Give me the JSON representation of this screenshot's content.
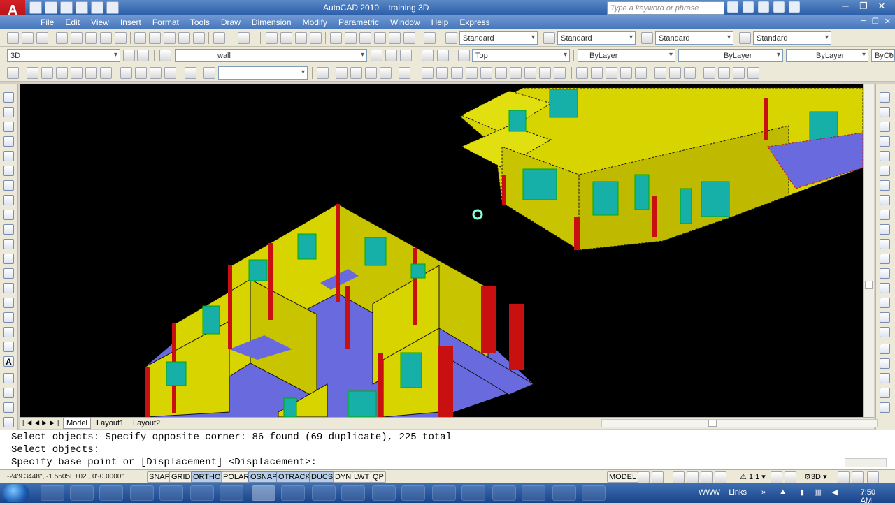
{
  "window": {
    "app_name": "AutoCAD 2010",
    "document_name": "training 3D",
    "search_placeholder": "Type a keyword or phrase",
    "app_logo_letter": "A"
  },
  "menu": [
    "File",
    "Edit",
    "View",
    "Insert",
    "Format",
    "Tools",
    "Draw",
    "Dimension",
    "Modify",
    "Parametric",
    "Window",
    "Help",
    "Express"
  ],
  "toolbar1": {
    "text_style": "Standard",
    "dim_style": "Standard",
    "table_style": "Standard",
    "mleader_style": "Standard"
  },
  "toolbar2": {
    "workspace": "3D",
    "layer": "wall",
    "view": "Top",
    "color": "ByLayer",
    "linetype": "ByLayer",
    "lineweight": "ByLayer",
    "plotstyle": "ByCo"
  },
  "tabs": [
    "Model",
    "Layout1",
    "Layout2"
  ],
  "command_lines": [
    "Select objects: Specify opposite corner: 86 found (69 duplicate), 225 total",
    "Select objects:",
    "Specify base point or [Displacement] <Displacement>:"
  ],
  "status": {
    "coordinates": "-24'9.3448\", -1.5505E+02 , 0'-0.0000\"",
    "toggles": [
      {
        "label": "SNAP",
        "on": false
      },
      {
        "label": "GRID",
        "on": false
      },
      {
        "label": "ORTHO",
        "on": true
      },
      {
        "label": "POLAR",
        "on": false
      },
      {
        "label": "OSNAP",
        "on": true
      },
      {
        "label": "OTRACK",
        "on": true
      },
      {
        "label": "DUCS",
        "on": true
      },
      {
        "label": "DYN",
        "on": false
      },
      {
        "label": "LWT",
        "on": false
      },
      {
        "label": "QP",
        "on": false
      }
    ],
    "space": "MODEL",
    "scale": "1:1",
    "workspace_label": "3D"
  },
  "taskbar": {
    "tray_text": "WWW",
    "links_label": "Links",
    "time": "7:50 AM"
  },
  "colors": {
    "wall": "#d8d400",
    "floor": "#6a6adf",
    "column": "#c81010",
    "window": "#17b0a8",
    "canvas": "#000000"
  }
}
